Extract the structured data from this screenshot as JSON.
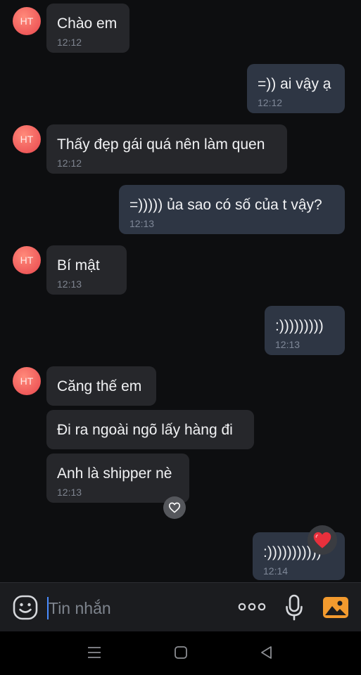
{
  "avatar_initials": "HT",
  "messages": [
    {
      "text": "Chào em",
      "time": "12:12"
    },
    {
      "text": "=)) ai vậy ạ",
      "time": "12:12"
    },
    {
      "text": "Thấy đẹp gái quá nên làm quen",
      "time": "12:12"
    },
    {
      "text": "=))))) ủa sao có số của t vậy?",
      "time": "12:13"
    },
    {
      "text": "Bí mật",
      "time": "12:13"
    },
    {
      "text": ":)))))))))",
      "time": "12:13"
    },
    {
      "text": "Căng thế em"
    },
    {
      "text": "Đi ra ngoài ngõ lấy hàng đi"
    },
    {
      "text": "Anh là shipper nè",
      "time": "12:13"
    },
    {
      "text": ":)))))))))))",
      "time": "12:14"
    }
  ],
  "composer": {
    "placeholder": "Tin nhắn"
  },
  "icons": {
    "sticker": "smiley-sticker-icon",
    "more": "more-options-icon",
    "mic": "microphone-icon",
    "photo": "photo-gallery-icon",
    "like_reaction": "heart-outline-icon",
    "love_reaction": "red-heart-icon"
  },
  "colors": {
    "background": "#0d0e10",
    "incoming_bubble": "#26272b",
    "outgoing_bubble": "#2e3644",
    "avatar": "#ef5a5a",
    "photo_icon": "#f29a2e"
  }
}
